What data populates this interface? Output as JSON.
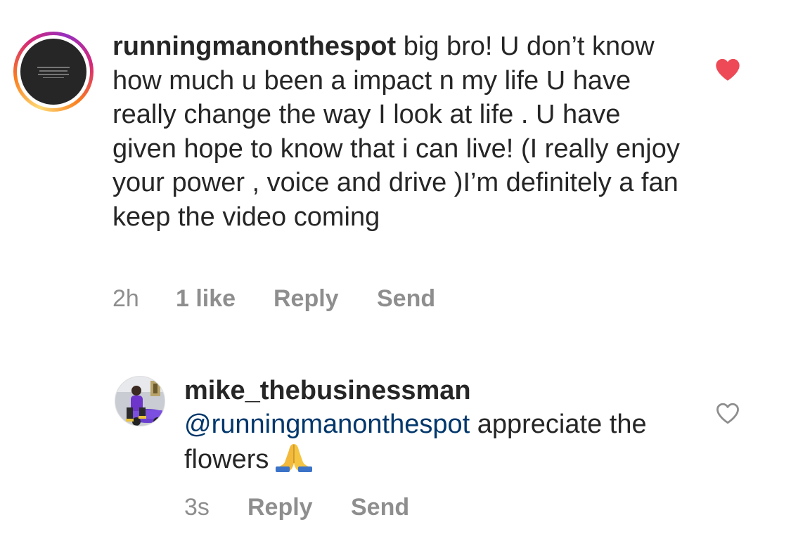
{
  "comment": {
    "username": "runningmanonthespot",
    "body": " big bro! U don’t know how much u been a impact n my life U have really change the way I look at life . U have given hope to know that i can live! (I really enjoy your power , voice and drive )I’m definitely a fan keep the video coming",
    "time": "2h",
    "likes": "1 like",
    "reply_label": "Reply",
    "send_label": "Send",
    "liked": true,
    "avatar_icon": "brand-logo-avatar",
    "ring_colors": [
      "#feda75",
      "#fa7e1e",
      "#d62976",
      "#962fbf"
    ],
    "heart_color": "#ed4956"
  },
  "reply": {
    "username": "mike_thebusinessman",
    "mention": "@runningmanonthespot",
    "body": " appreciate the flowers",
    "emoji": "folded-hands-emoji",
    "time": "3s",
    "reply_label": "Reply",
    "send_label": "Send",
    "liked": false,
    "mention_color": "#00376b"
  }
}
